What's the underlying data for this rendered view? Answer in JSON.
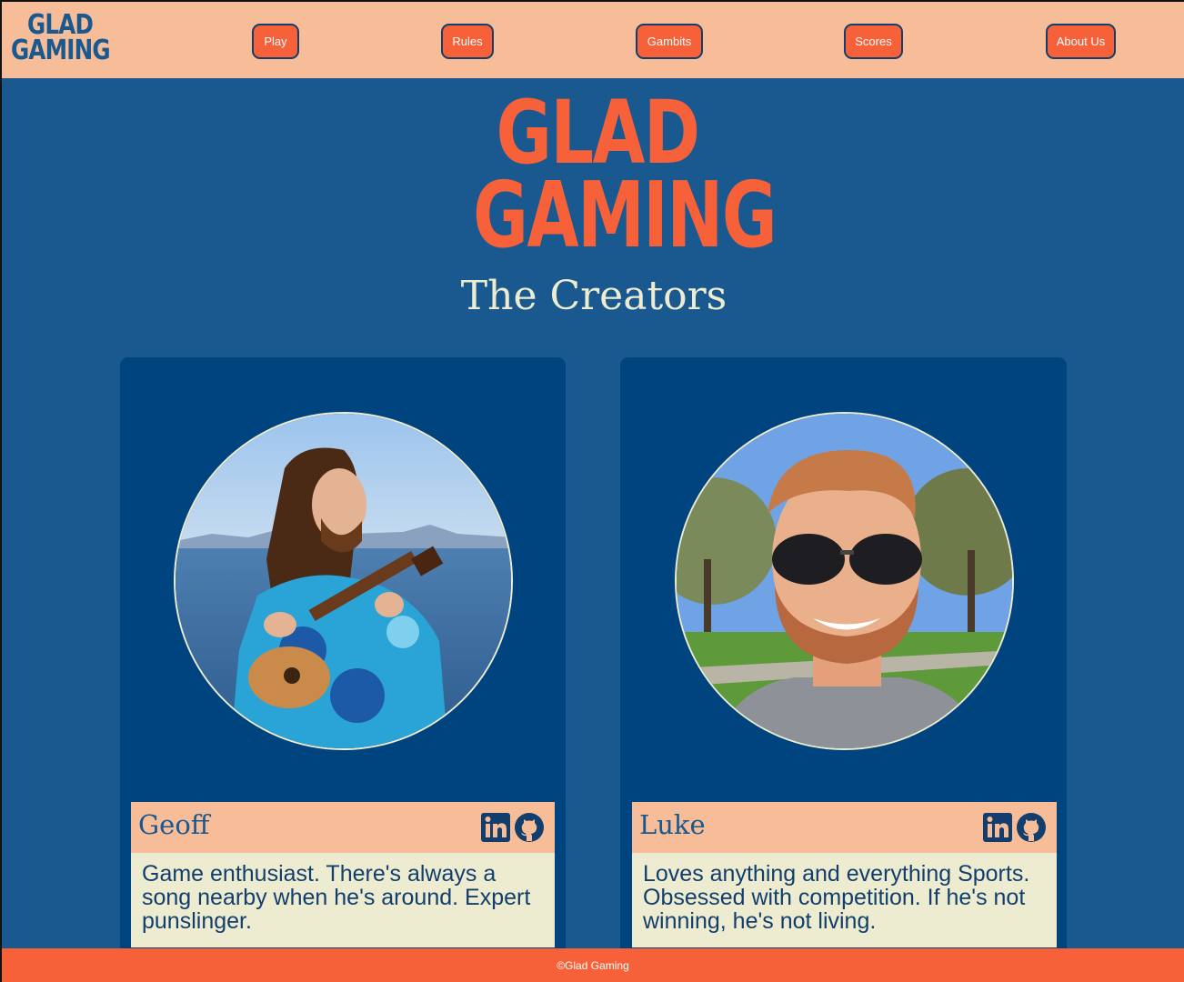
{
  "brand": {
    "line1": "GLAD",
    "line2": "GAMING"
  },
  "nav": [
    {
      "label": "Play"
    },
    {
      "label": "Rules"
    },
    {
      "label": "Gambits"
    },
    {
      "label": "Scores"
    },
    {
      "label": "About Us"
    }
  ],
  "hero": {
    "line1": "GLAD",
    "line2": "GAMING"
  },
  "page_title": "The Creators",
  "creators": [
    {
      "name": "Geoff",
      "bio": "Game enthusiast. There's always a song nearby when he's around. Expert punslinger.",
      "icons": [
        "linkedin-icon",
        "github-icon"
      ]
    },
    {
      "name": "Luke",
      "bio": "Loves anything and everything Sports. Obsessed with competition. If he's not winning, he's not living.",
      "icons": [
        "linkedin-icon",
        "github-icon"
      ]
    }
  ],
  "footer": "©Glad Gaming",
  "colors": {
    "header_bg": "#f6bd98",
    "page_bg": "#1a5890",
    "card_bg": "#00447f",
    "accent": "#f66139",
    "cream": "#edecd0"
  }
}
